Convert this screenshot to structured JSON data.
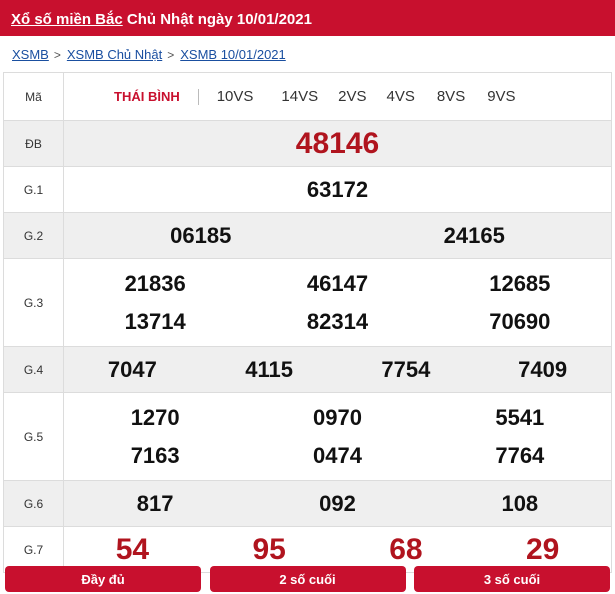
{
  "header": {
    "title_link": "Xổ số miền Bắc",
    "title_rest": " Chủ Nhật ngày 10/01/2021"
  },
  "breadcrumb": [
    "XSMB",
    "XSMB Chủ Nhật",
    "XSMB 10/01/2021"
  ],
  "table": {
    "code_label": "Mã",
    "province": "THÁI BÌNH",
    "codes": [
      "10VS",
      "14VS",
      "2VS",
      "4VS",
      "8VS",
      "9VS"
    ],
    "rows": [
      {
        "label": "ĐB",
        "lines": [
          [
            "48146"
          ]
        ]
      },
      {
        "label": "G.1",
        "lines": [
          [
            "63172"
          ]
        ]
      },
      {
        "label": "G.2",
        "lines": [
          [
            "06185",
            "24165"
          ]
        ]
      },
      {
        "label": "G.3",
        "lines": [
          [
            "21836",
            "46147",
            "12685"
          ],
          [
            "13714",
            "82314",
            "70690"
          ]
        ]
      },
      {
        "label": "G.4",
        "lines": [
          [
            "7047",
            "4115",
            "7754",
            "7409"
          ]
        ]
      },
      {
        "label": "G.5",
        "lines": [
          [
            "1270",
            "0970",
            "5541"
          ],
          [
            "7163",
            "0474",
            "7764"
          ]
        ]
      },
      {
        "label": "G.6",
        "lines": [
          [
            "817",
            "092",
            "108"
          ]
        ]
      },
      {
        "label": "G.7",
        "lines": [
          [
            "54",
            "95",
            "68",
            "29"
          ]
        ]
      }
    ]
  },
  "buttons": [
    "Đầy đủ",
    "2 số cuối",
    "3 số cuối"
  ],
  "colors": {
    "brand_red": "#c8102e",
    "prize_red": "#b0141e",
    "row_shade": "#efefef"
  }
}
